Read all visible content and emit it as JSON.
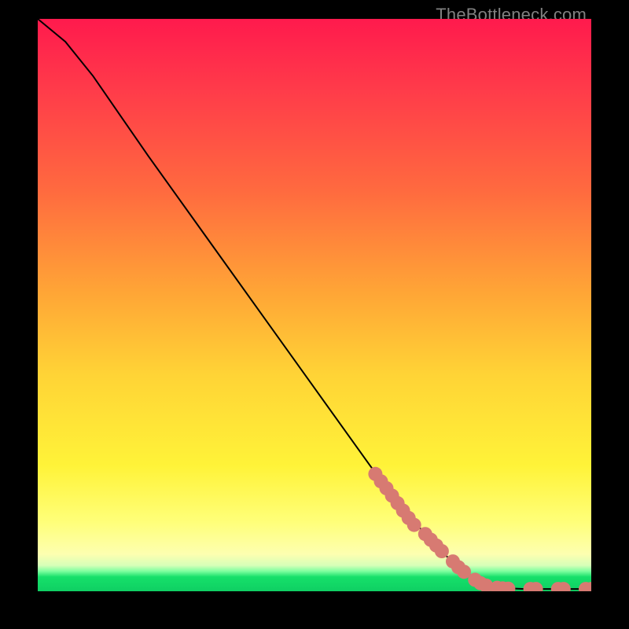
{
  "watermark": "TheBottleneck.com",
  "chart_data": {
    "type": "line",
    "title": "",
    "xlabel": "",
    "ylabel": "",
    "xlim": [
      0,
      100
    ],
    "ylim": [
      0,
      100
    ],
    "curve": [
      {
        "x": 0,
        "y": 100
      },
      {
        "x": 5,
        "y": 96
      },
      {
        "x": 10,
        "y": 90
      },
      {
        "x": 15,
        "y": 83
      },
      {
        "x": 20,
        "y": 76
      },
      {
        "x": 30,
        "y": 62.5
      },
      {
        "x": 40,
        "y": 49
      },
      {
        "x": 50,
        "y": 35.5
      },
      {
        "x": 60,
        "y": 22
      },
      {
        "x": 65,
        "y": 15.5
      },
      {
        "x": 70,
        "y": 10
      },
      {
        "x": 75,
        "y": 5
      },
      {
        "x": 80,
        "y": 1.5
      },
      {
        "x": 83,
        "y": 0.6
      },
      {
        "x": 88,
        "y": 0.4
      },
      {
        "x": 94,
        "y": 0.4
      },
      {
        "x": 100,
        "y": 0.4
      }
    ],
    "markers": [
      {
        "x": 61,
        "y": 20.5
      },
      {
        "x": 62,
        "y": 19.2
      },
      {
        "x": 63,
        "y": 18
      },
      {
        "x": 64,
        "y": 16.7
      },
      {
        "x": 65,
        "y": 15.4
      },
      {
        "x": 66,
        "y": 14.1
      },
      {
        "x": 67,
        "y": 12.8
      },
      {
        "x": 68,
        "y": 11.6
      },
      {
        "x": 70,
        "y": 10
      },
      {
        "x": 71,
        "y": 9
      },
      {
        "x": 72,
        "y": 8
      },
      {
        "x": 73,
        "y": 7
      },
      {
        "x": 75,
        "y": 5.2
      },
      {
        "x": 76,
        "y": 4.2
      },
      {
        "x": 77,
        "y": 3.4
      },
      {
        "x": 79,
        "y": 2.0
      },
      {
        "x": 80,
        "y": 1.4
      },
      {
        "x": 81,
        "y": 1.0
      },
      {
        "x": 83,
        "y": 0.6
      },
      {
        "x": 84,
        "y": 0.5
      },
      {
        "x": 85,
        "y": 0.45
      },
      {
        "x": 89,
        "y": 0.4
      },
      {
        "x": 90,
        "y": 0.4
      },
      {
        "x": 94,
        "y": 0.4
      },
      {
        "x": 95,
        "y": 0.4
      },
      {
        "x": 99,
        "y": 0.4
      },
      {
        "x": 100,
        "y": 0.4
      }
    ],
    "marker_color": "#d77a72",
    "line_color": "#000000"
  }
}
